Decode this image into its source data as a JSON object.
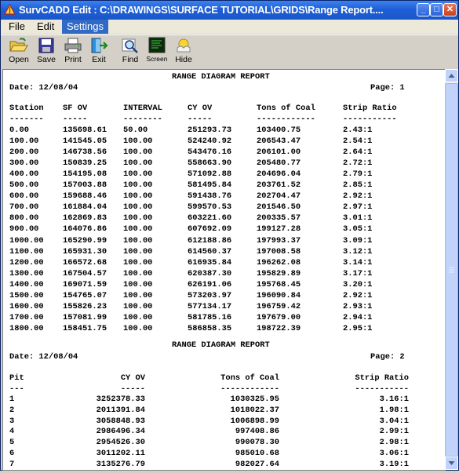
{
  "window": {
    "title": "SurvCADD Edit : C:\\DRAWINGS\\SURFACE TUTORIAL\\GRIDS\\Range Report....",
    "min": "_",
    "max": "□",
    "close": "✕"
  },
  "menu": [
    "File",
    "Edit",
    "Settings"
  ],
  "toolbar": [
    {
      "label": "Open",
      "icon": "folder-open-icon"
    },
    {
      "label": "Save",
      "icon": "floppy-disk-icon"
    },
    {
      "label": "Print",
      "icon": "printer-icon"
    },
    {
      "label": "Exit",
      "icon": "exit-door-icon"
    },
    {
      "label": "Find",
      "icon": "magnifier-icon"
    },
    {
      "label": "Screen",
      "icon": "screen-icon"
    },
    {
      "label": "Hide",
      "icon": "hide-icon"
    }
  ],
  "report1": {
    "title": "RANGE DIAGRAM REPORT",
    "date": "Date: 12/08/04",
    "page": "Page: 1",
    "headers": [
      "Station",
      "SF OV",
      "INTERVAL",
      "CY OV",
      "Tons of Coal",
      "Strip Ratio"
    ],
    "underlines": [
      "-------",
      "-----",
      "--------",
      "-----",
      "------------",
      "-----------"
    ],
    "rows": [
      [
        "0.00",
        "135698.61",
        "50.00",
        "251293.73",
        "103400.75",
        "2.43:1"
      ],
      [
        "100.00",
        "141545.05",
        "100.00",
        "524240.92",
        "206543.47",
        "2.54:1"
      ],
      [
        "200.00",
        "146738.56",
        "100.00",
        "543476.16",
        "206101.00",
        "2.64:1"
      ],
      [
        "300.00",
        "150839.25",
        "100.00",
        "558663.90",
        "205480.77",
        "2.72:1"
      ],
      [
        "400.00",
        "154195.08",
        "100.00",
        "571092.88",
        "204696.04",
        "2.79:1"
      ],
      [
        "500.00",
        "157003.88",
        "100.00",
        "581495.84",
        "203761.52",
        "2.85:1"
      ],
      [
        "600.00",
        "159688.46",
        "100.00",
        "591438.76",
        "202704.47",
        "2.92:1"
      ],
      [
        "700.00",
        "161884.04",
        "100.00",
        "599570.53",
        "201546.50",
        "2.97:1"
      ],
      [
        "800.00",
        "162869.83",
        "100.00",
        "603221.60",
        "200335.57",
        "3.01:1"
      ],
      [
        "900.00",
        "164076.86",
        "100.00",
        "607692.09",
        "199127.28",
        "3.05:1"
      ],
      [
        "1000.00",
        "165290.99",
        "100.00",
        "612188.86",
        "197993.37",
        "3.09:1"
      ],
      [
        "1100.00",
        "165931.30",
        "100.00",
        "614560.37",
        "197008.58",
        "3.12:1"
      ],
      [
        "1200.00",
        "166572.68",
        "100.00",
        "616935.84",
        "196262.08",
        "3.14:1"
      ],
      [
        "1300.00",
        "167504.57",
        "100.00",
        "620387.30",
        "195829.89",
        "3.17:1"
      ],
      [
        "1400.00",
        "169071.59",
        "100.00",
        "626191.06",
        "195768.45",
        "3.20:1"
      ],
      [
        "1500.00",
        "154765.07",
        "100.00",
        "573203.97",
        "196090.84",
        "2.92:1"
      ],
      [
        "1600.00",
        "155826.23",
        "100.00",
        "577134.17",
        "196759.42",
        "2.93:1"
      ],
      [
        "1700.00",
        "157081.99",
        "100.00",
        "581785.16",
        "197679.00",
        "2.94:1"
      ],
      [
        "1800.00",
        "158451.75",
        "100.00",
        "586858.35",
        "198722.39",
        "2.95:1"
      ]
    ]
  },
  "report2": {
    "title": "RANGE DIAGRAM REPORT",
    "date": "Date: 12/08/04",
    "page": "Page: 2",
    "headers": [
      "Pit",
      "CY OV",
      "Tons of Coal",
      "Strip Ratio"
    ],
    "underlines": [
      "---",
      "-----",
      "------------",
      "-----------"
    ],
    "rows": [
      [
        "1",
        "3252378.33",
        "1030325.95",
        "3.16:1"
      ],
      [
        "2",
        "2011391.84",
        "1018022.37",
        "1.98:1"
      ],
      [
        "3",
        "3058848.93",
        "1006898.99",
        "3.04:1"
      ],
      [
        "4",
        "2986496.34",
        "997408.86",
        "2.99:1"
      ],
      [
        "5",
        "2954526.30",
        "990078.30",
        "2.98:1"
      ],
      [
        "6",
        "3011202.11",
        "985010.68",
        "3.06:1"
      ],
      [
        "7",
        "3135276.79",
        "982027.64",
        "3.19:1"
      ]
    ]
  }
}
